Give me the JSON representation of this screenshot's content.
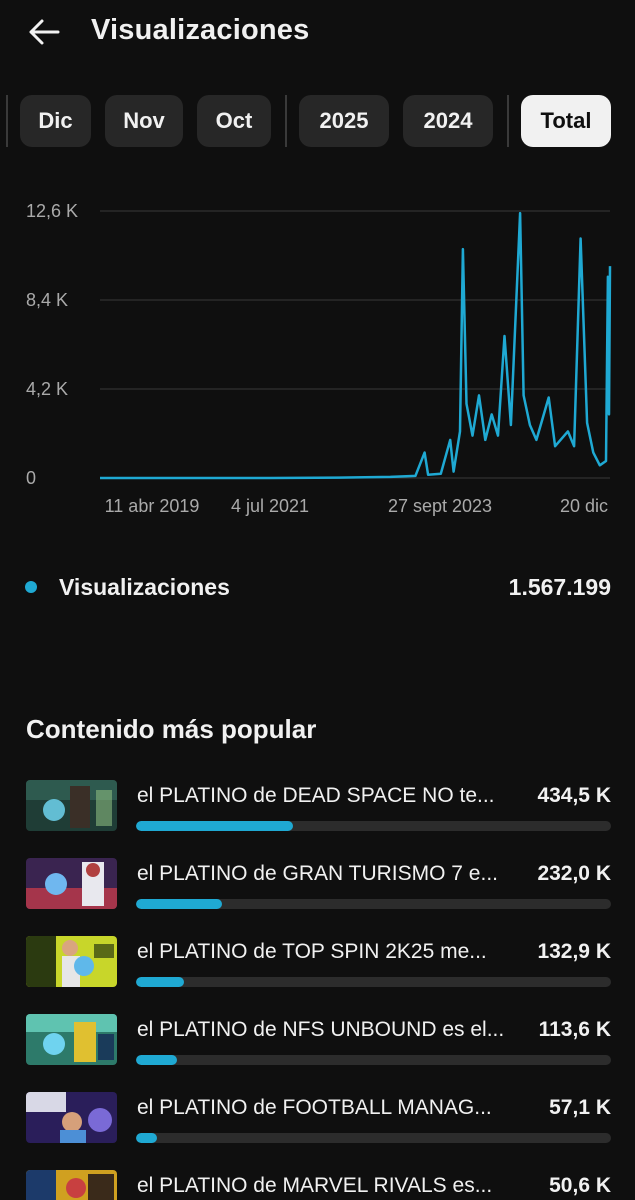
{
  "header": {
    "title": "Visualizaciones",
    "back_icon": "arrow-left-icon"
  },
  "chips": [
    {
      "label": "Dic",
      "active": false
    },
    {
      "label": "Nov",
      "active": false
    },
    {
      "label": "Oct",
      "active": false
    },
    {
      "label": "2025",
      "active": false
    },
    {
      "label": "2024",
      "active": false
    },
    {
      "label": "Total",
      "active": true
    }
  ],
  "chart_data": {
    "type": "line",
    "y_ticks": [
      "12,6 K",
      "8,4 K",
      "4,2 K",
      "0"
    ],
    "x_ticks": [
      "11 abr 2019",
      "4 jul 2021",
      "27 sept 2023",
      "20 dic"
    ],
    "ylim": [
      0,
      12600
    ],
    "x_range": [
      "2019-04-11",
      "2025-12-20"
    ],
    "grid": true,
    "series": [
      {
        "color": "#1fa9d3",
        "points": [
          [
            "2019-04-11",
            0
          ],
          [
            "2021-07-04",
            0
          ],
          [
            "2022-06-01",
            20
          ],
          [
            "2023-02-01",
            50
          ],
          [
            "2023-06-01",
            100
          ],
          [
            "2023-07-15",
            1200
          ],
          [
            "2023-08-01",
            150
          ],
          [
            "2023-10-01",
            200
          ],
          [
            "2023-11-15",
            1800
          ],
          [
            "2023-12-01",
            300
          ],
          [
            "2024-01-01",
            2200
          ],
          [
            "2024-01-15",
            10800
          ],
          [
            "2024-02-01",
            3500
          ],
          [
            "2024-03-01",
            2000
          ],
          [
            "2024-04-01",
            3900
          ],
          [
            "2024-05-01",
            1800
          ],
          [
            "2024-06-01",
            3000
          ],
          [
            "2024-07-01",
            2000
          ],
          [
            "2024-08-01",
            6700
          ],
          [
            "2024-09-01",
            2500
          ],
          [
            "2024-10-15",
            12500
          ],
          [
            "2024-11-01",
            3900
          ],
          [
            "2024-12-01",
            2500
          ],
          [
            "2025-01-01",
            1800
          ],
          [
            "2025-03-01",
            3800
          ],
          [
            "2025-04-01",
            1500
          ],
          [
            "2025-06-01",
            2200
          ],
          [
            "2025-07-01",
            1500
          ],
          [
            "2025-08-01",
            11300
          ],
          [
            "2025-09-01",
            2600
          ],
          [
            "2025-10-01",
            1200
          ],
          [
            "2025-11-01",
            600
          ],
          [
            "2025-12-01",
            800
          ],
          [
            "2025-12-10",
            9500
          ],
          [
            "2025-12-15",
            3000
          ],
          [
            "2025-12-20",
            10000
          ]
        ]
      }
    ]
  },
  "legend": {
    "label": "Visualizaciones",
    "value": "1.567.199",
    "color": "#1fa9d3"
  },
  "popular": {
    "title": "Contenido más popular",
    "items": [
      {
        "title": "el PLATINO de DEAD SPACE NO te...",
        "value": "434,5 K",
        "share": 0.33
      },
      {
        "title": "el PLATINO de GRAN TURISMO 7 e...",
        "value": "232,0 K",
        "share": 0.18
      },
      {
        "title": "el PLATINO de TOP SPIN 2K25 me...",
        "value": "132,9 K",
        "share": 0.1
      },
      {
        "title": "el PLATINO de NFS UNBOUND es el...",
        "value": "113,6 K",
        "share": 0.087
      },
      {
        "title": "el PLATINO de FOOTBALL MANAG...",
        "value": "57,1 K",
        "share": 0.044
      },
      {
        "title": "el PLATINO de MARVEL RIVALS es...",
        "value": "50,6 K",
        "share": 0.039
      }
    ]
  }
}
